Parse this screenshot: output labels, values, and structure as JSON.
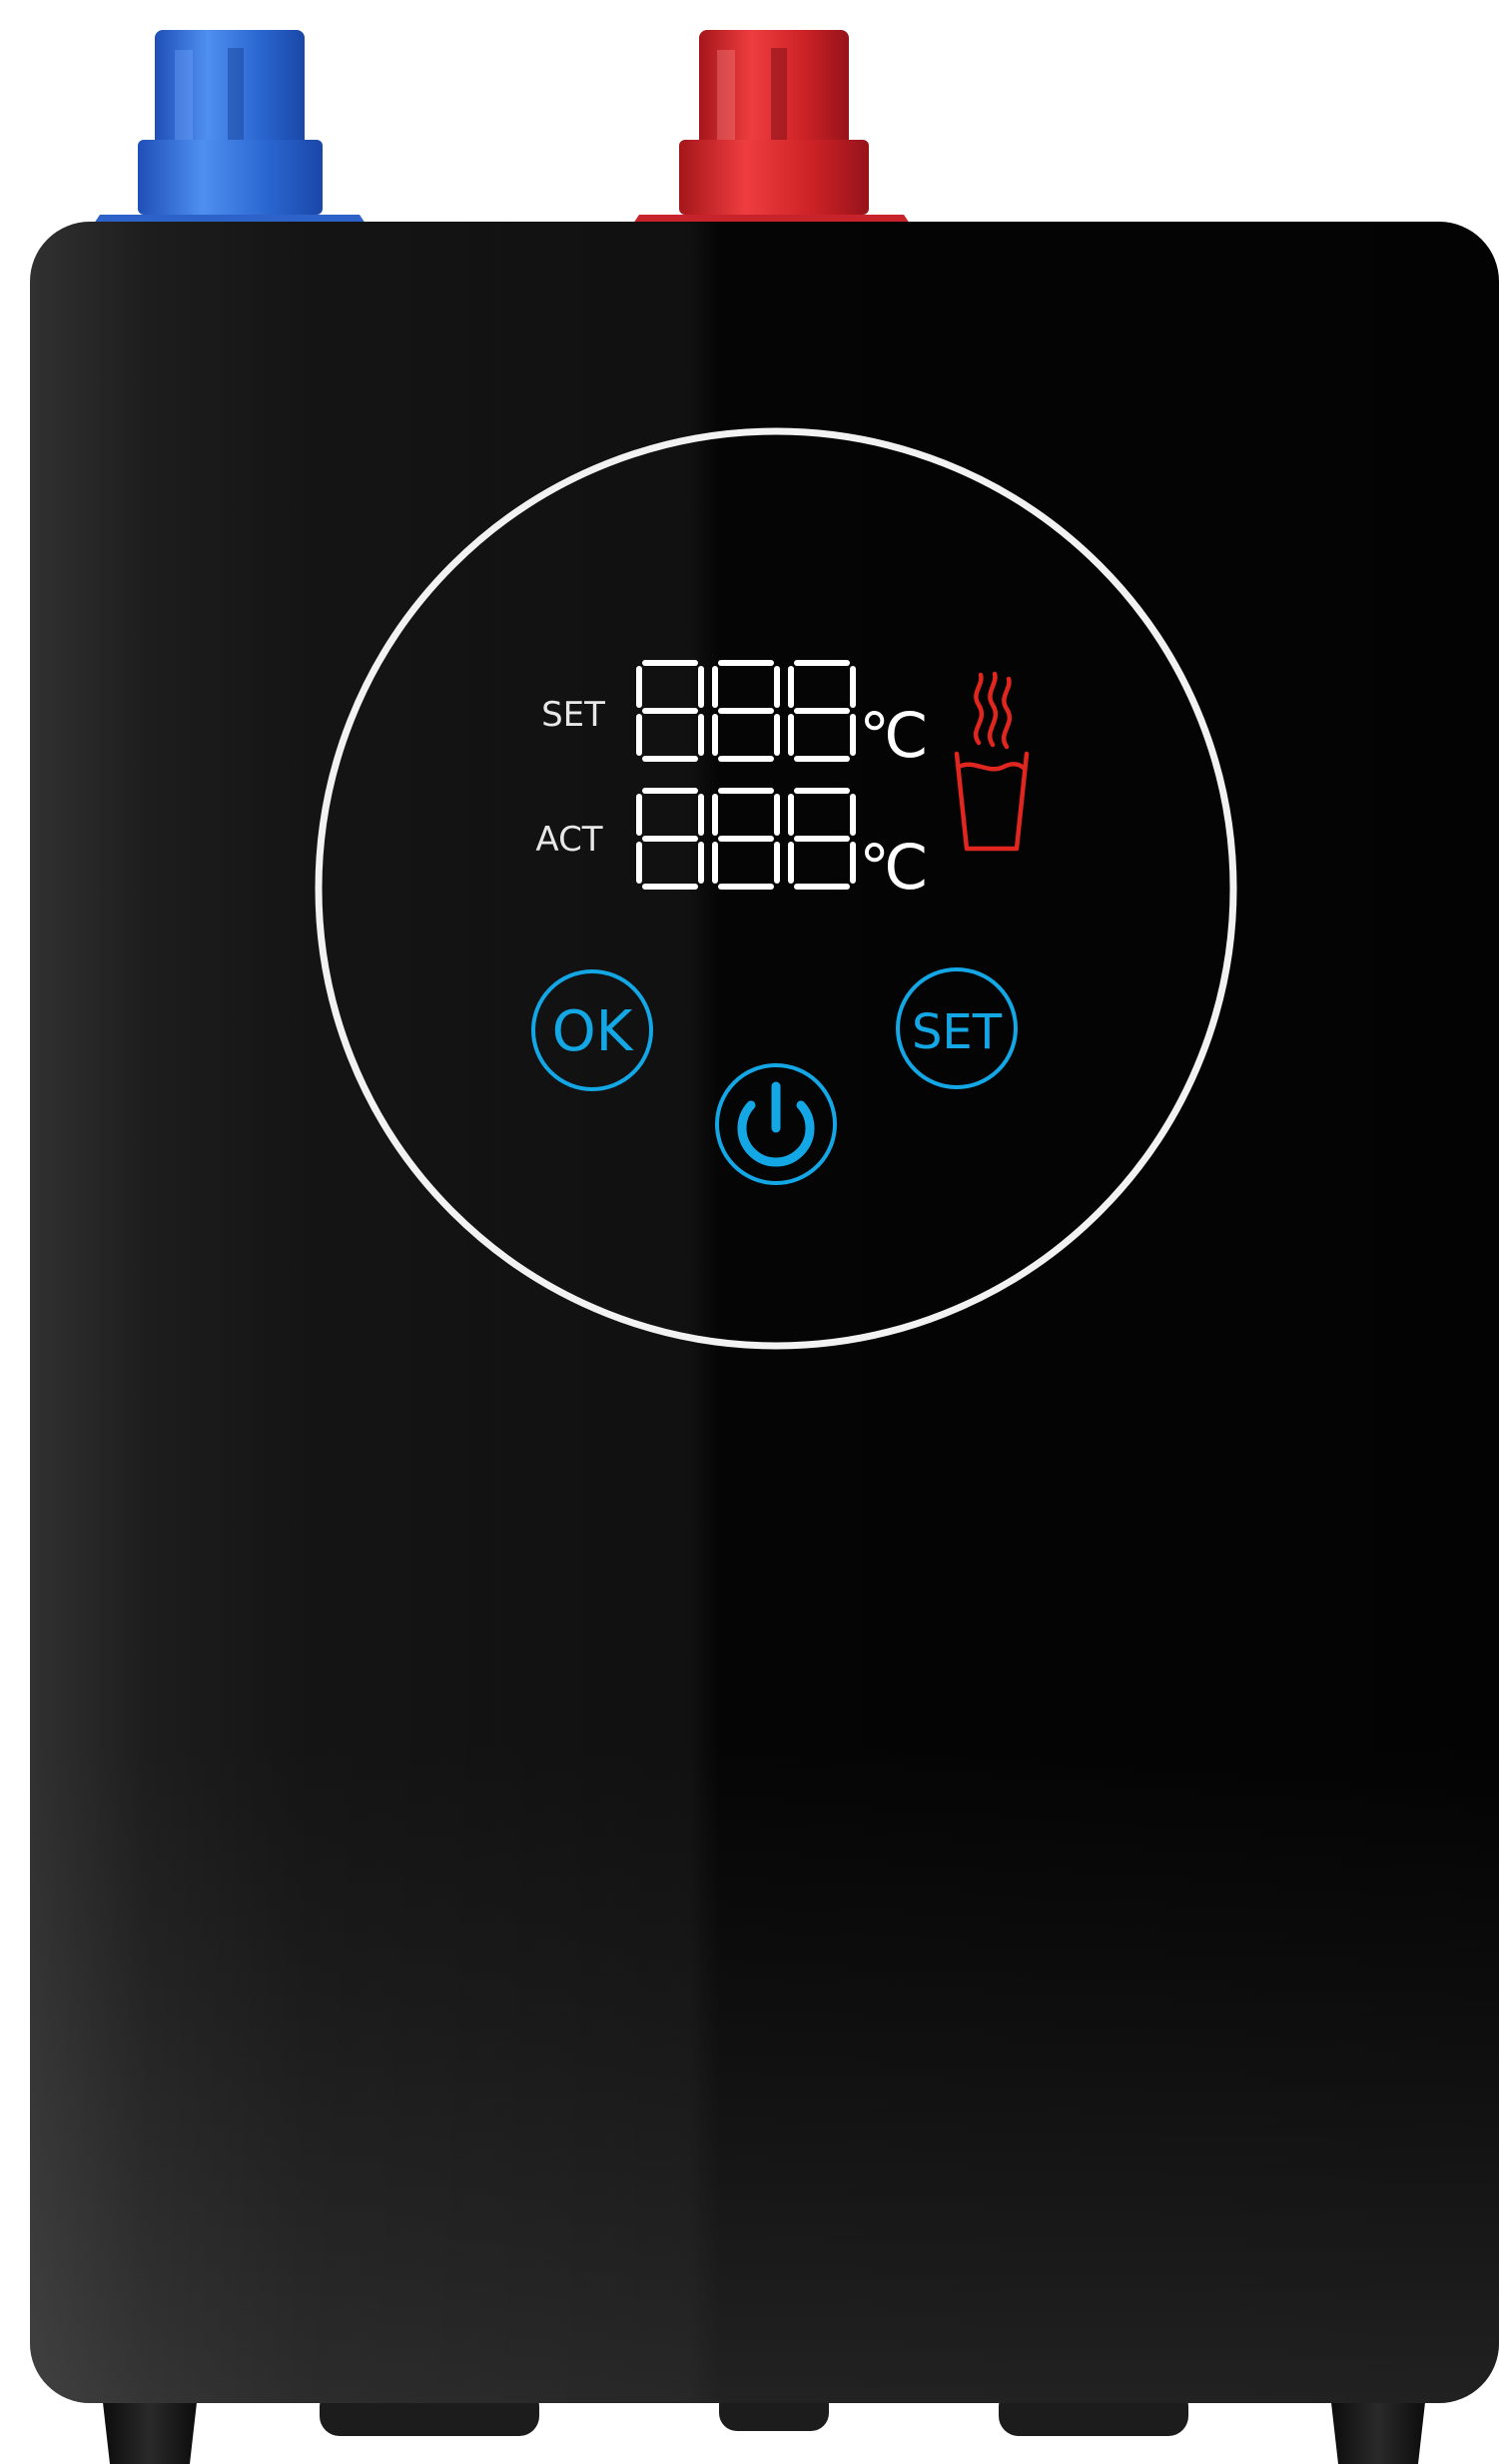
{
  "device": {
    "body_color": "#0b0b0b",
    "fitting_cold_color": "#2f6fd6",
    "fitting_hot_color": "#d8262b"
  },
  "display": {
    "set_label": "SET",
    "act_label": "ACT",
    "set_digits": "888",
    "act_digits": "888",
    "unit": "℃",
    "segment_color": "#ffffff",
    "hot_icon_color": "#e0261e"
  },
  "controls": {
    "ok_label": "OK",
    "set_label": "SET",
    "button_color": "#14a7e6"
  }
}
